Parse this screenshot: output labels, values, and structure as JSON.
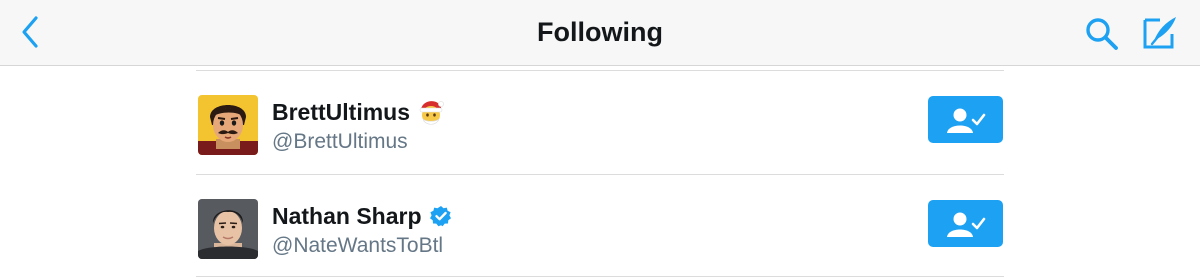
{
  "nav": {
    "title": "Following",
    "back_icon": "chevron-left-icon",
    "search_icon": "search-icon",
    "compose_icon": "compose-tweet-icon",
    "accent_color": "#1da1f2"
  },
  "users": [
    {
      "display_name": "BrettUltimus",
      "handle": "@BrettUltimus",
      "badge": "santa-emoji-icon",
      "avatar": "cartoon-avatar",
      "follow_state": "following",
      "follow_icon": "following-check-icon"
    },
    {
      "display_name": "Nathan Sharp",
      "handle": "@NateWantsToBtl",
      "badge": "verified-badge-icon",
      "avatar": "photo-avatar",
      "follow_state": "following",
      "follow_icon": "following-check-icon"
    }
  ]
}
